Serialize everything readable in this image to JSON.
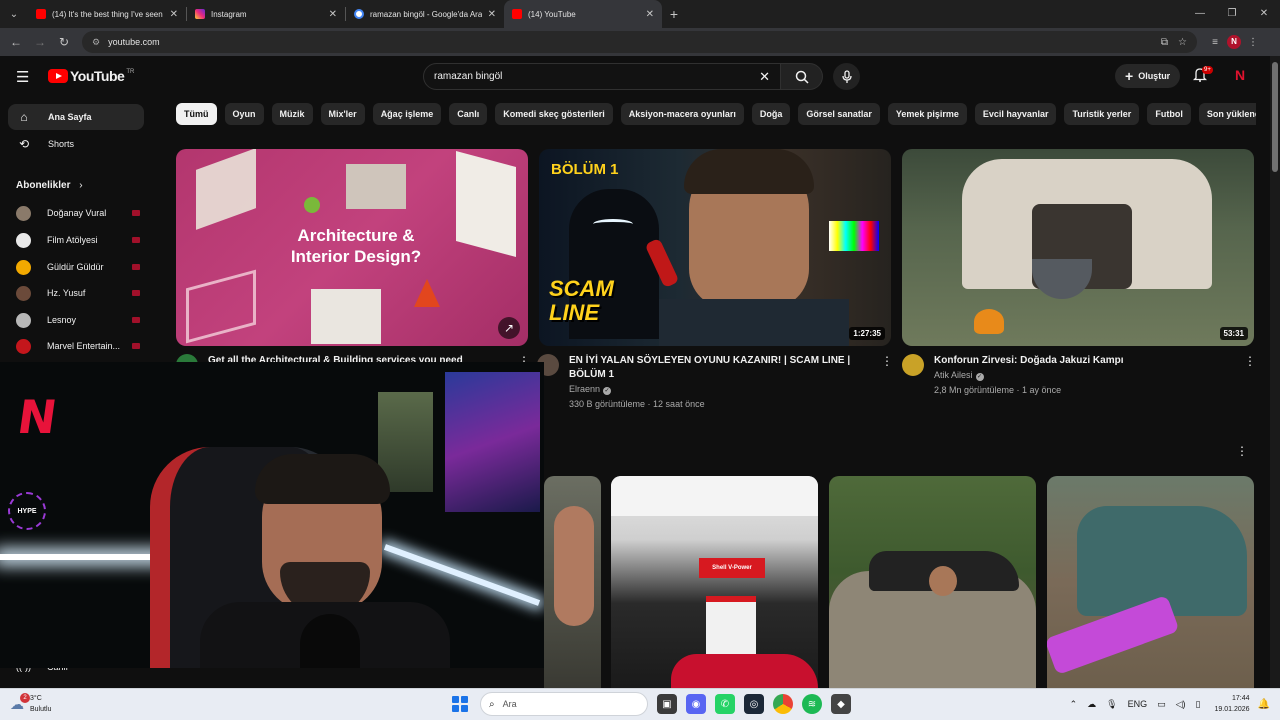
{
  "browser": {
    "tabs": [
      {
        "title": "(14) It's the best thing I've seen",
        "favicon_color": "#ff0000"
      },
      {
        "title": "Instagram",
        "favicon_color": "#d6249f"
      },
      {
        "title": "ramazan bingöl - Google'da Ara",
        "favicon_color": "#4285f4"
      },
      {
        "title": "(14) YouTube",
        "favicon_color": "#ff0000",
        "active": true
      }
    ],
    "url": "youtube.com",
    "profile_letter": "N"
  },
  "youtube": {
    "logo_text": "YouTube",
    "logo_country": "TR",
    "search_value": "ramazan bingöl",
    "create_label": "Oluştur",
    "notification_count": "9+",
    "sidebar": {
      "items": [
        {
          "label": "Ana Sayfa",
          "icon": "home-icon"
        },
        {
          "label": "Shorts",
          "icon": "shorts-icon"
        }
      ],
      "subs_title": "Abonelikler",
      "subscriptions": [
        {
          "name": "Doğanay Vural",
          "color": "#8a7a6a"
        },
        {
          "name": "Film Atölyesi",
          "color": "#e8e8e8"
        },
        {
          "name": "Güldür Güldür",
          "color": "#f2a900"
        },
        {
          "name": "Hz. Yusuf",
          "color": "#6b4a3a"
        },
        {
          "name": "Lesnoy",
          "color": "#b8b8b8"
        },
        {
          "name": "Marvel Entertain...",
          "color": "#c4161c"
        }
      ],
      "bottom_label": "Canlı"
    },
    "chips": [
      "Tümü",
      "Oyun",
      "Müzik",
      "Mix'ler",
      "Ağaç işleme",
      "Canlı",
      "Komedi skeç gösterileri",
      "Aksiyon-macera oyunları",
      "Doğa",
      "Görsel sanatlar",
      "Yemek pişirme",
      "Evcil hayvanlar",
      "Turistik yerler",
      "Futbol",
      "Son yüklenenler"
    ],
    "videos": [
      {
        "title": "Get all the Architectural & Building services you need",
        "thumb_text": "Architecture & Interior Design?",
        "channel": "",
        "stats": "",
        "duration": ""
      },
      {
        "title": "EN İYİ YALAN SÖYLEYEN OYUNU KAZANIR! | SCAM LINE | BÖLÜM 1",
        "thumb_badge": "BÖLÜM 1",
        "thumb_logo": "SCAM LINE",
        "channel": "Elraenn",
        "stats": "330 B görüntüleme · 12 saat önce",
        "duration": "1:27:35"
      },
      {
        "title": "Konforun Zirvesi: Doğada Jakuzi Kampı",
        "channel": "Atik Ailesi",
        "stats": "2,8 Mn görüntüleme · 1 ay önce",
        "duration": "53:31"
      }
    ],
    "short_sign": "Shell V-Power"
  },
  "webcam": {
    "logo": "N",
    "hype": "HYPE"
  },
  "taskbar": {
    "weather_temp": "3°C",
    "weather_desc": "Bulutlu",
    "weather_badge": "2",
    "search_placeholder": "Ara",
    "lang": "ENG",
    "time": "17:44",
    "date": "19.01.2026"
  }
}
